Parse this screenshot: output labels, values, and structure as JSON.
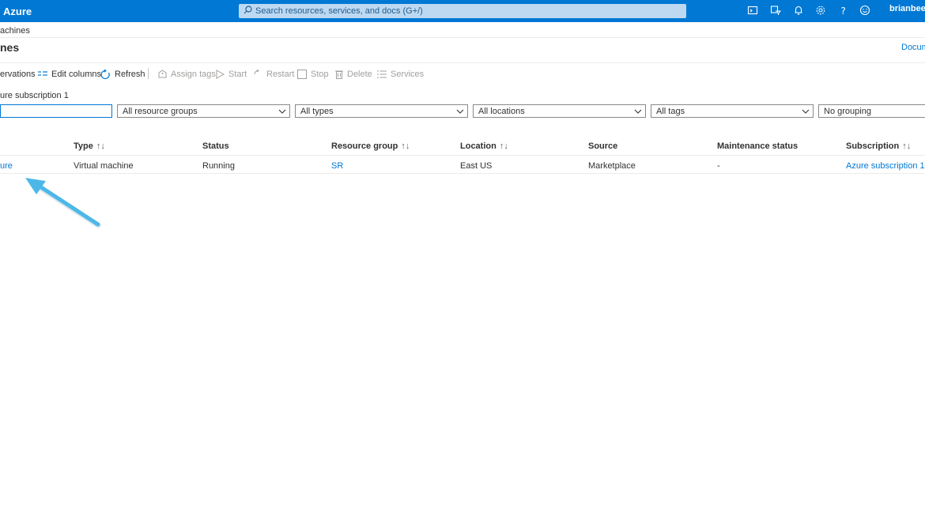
{
  "topbar": {
    "brand": "Azure",
    "search_placeholder": "Search resources, services, and docs (G+/)",
    "user": "brianbeele"
  },
  "breadcrumb": "achines",
  "page": {
    "title": "nes",
    "doc_link": "Docum"
  },
  "toolbar": {
    "reservations": "ervations",
    "edit_columns": "Edit columns",
    "refresh": "Refresh",
    "assign_tags": "Assign tags",
    "start": "Start",
    "restart": "Restart",
    "stop": "Stop",
    "delete": "Delete",
    "services": "Services"
  },
  "subscription_filter": "ure subscription 1",
  "filters": {
    "search_value": "",
    "resource_groups": "All resource groups",
    "types": "All types",
    "locations": "All locations",
    "tags": "All tags",
    "grouping": "No grouping"
  },
  "table": {
    "columns": {
      "type": "Type",
      "status": "Status",
      "resource_group": "Resource group",
      "location": "Location",
      "source": "Source",
      "maintenance": "Maintenance status",
      "subscription": "Subscription"
    },
    "sort_glyph": "↑↓",
    "rows": [
      {
        "name": "ure",
        "type": "Virtual machine",
        "status": "Running",
        "resource_group": "SR",
        "location": "East US",
        "source": "Marketplace",
        "maintenance": "-",
        "subscription": "Azure subscription 1"
      }
    ]
  },
  "colors": {
    "accent": "#0078d4",
    "annotation_arrow": "#4db8e8"
  }
}
